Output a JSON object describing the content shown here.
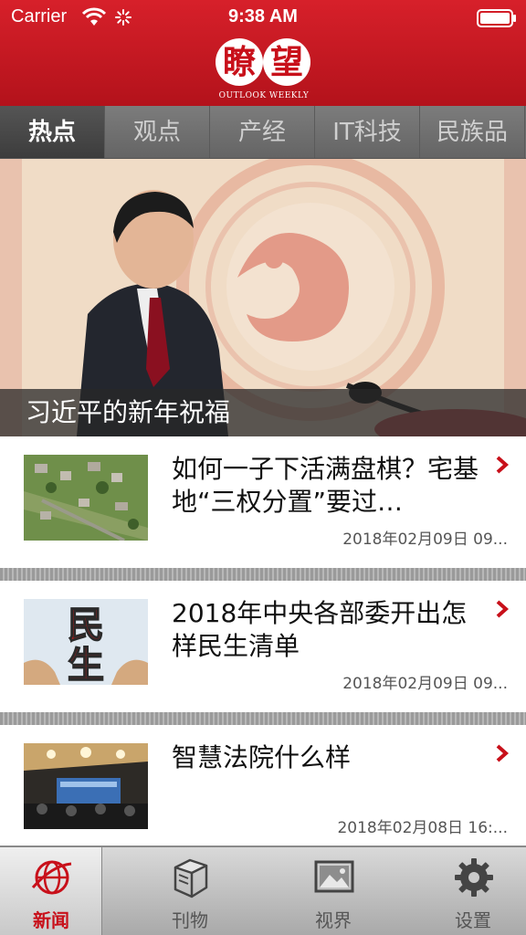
{
  "status_bar": {
    "carrier": "Carrier",
    "time": "9:38 AM"
  },
  "header": {
    "logo_char_1": "瞭",
    "logo_char_2": "望",
    "logo_subtitle": "OUTLOOK WEEKLY"
  },
  "tabs": [
    {
      "label": "热点",
      "active": true
    },
    {
      "label": "观点"
    },
    {
      "label": "产经"
    },
    {
      "label": "IT科技"
    },
    {
      "label": "民族品"
    }
  ],
  "hero": {
    "caption": "习近平的新年祝福"
  },
  "news": [
    {
      "title": " 如何一子下活满盘棋？宅基地“三权分置”要过…",
      "date": "2018年02月09日 09..."
    },
    {
      "title": "2018年中央各部委开出怎样民生清单",
      "date": "2018年02月09日 09..."
    },
    {
      "title": "智慧法院什么样",
      "date": "2018年02月08日 16:..."
    }
  ],
  "thumb2_text": {
    "line1": "民",
    "line2": "生"
  },
  "tabbar": [
    {
      "label": "新闻",
      "icon": "globe-icon",
      "active": true
    },
    {
      "label": "刊物",
      "icon": "book-icon"
    },
    {
      "label": "视界",
      "icon": "picture-icon"
    },
    {
      "label": "设置",
      "icon": "gear-icon"
    }
  ],
  "colors": {
    "brand_red": "#c8101a",
    "tab_bar_gray": "#707070"
  }
}
